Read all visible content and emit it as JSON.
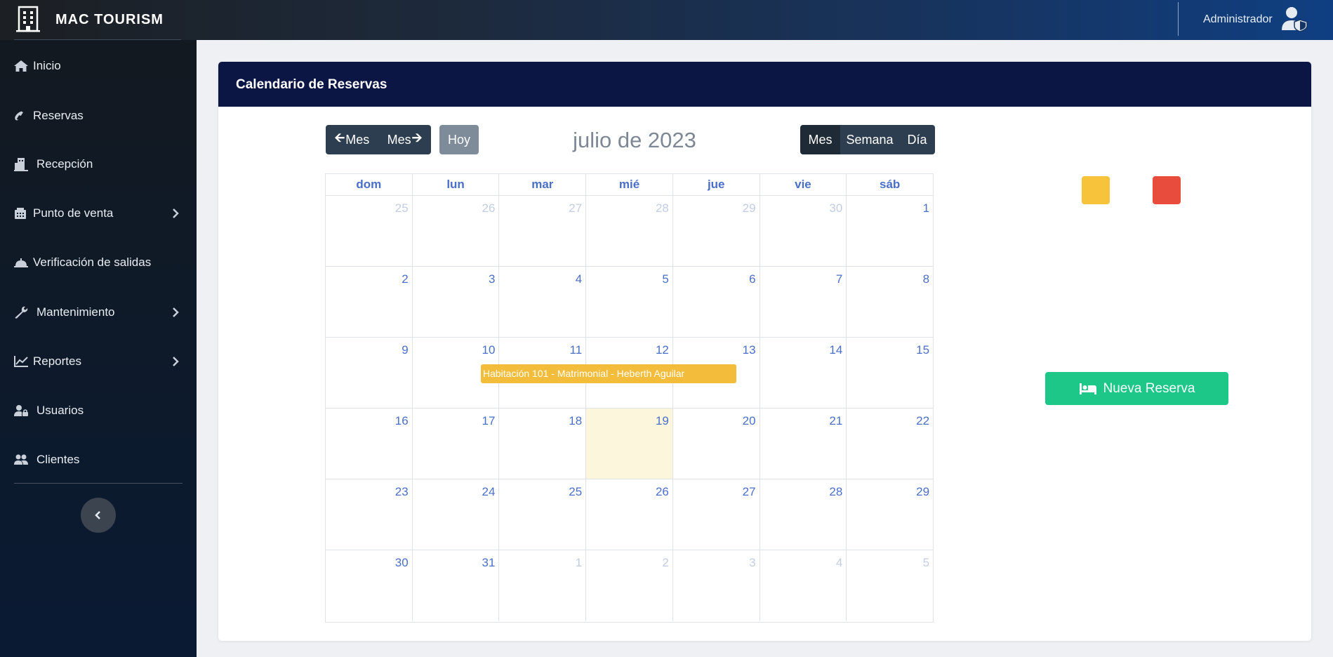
{
  "app": {
    "name": "MAC TOURISM"
  },
  "header": {
    "user_label": "Administrador"
  },
  "sidebar": {
    "items": [
      {
        "label": "Inicio",
        "icon": "home-icon",
        "has_submenu": false
      },
      {
        "label": "Reservas",
        "icon": "phone-icon",
        "has_submenu": false
      },
      {
        "label": "Recepción",
        "icon": "concierge-icon",
        "has_submenu": false
      },
      {
        "label": "Punto de venta",
        "icon": "register-icon",
        "has_submenu": true
      },
      {
        "label": "Verificación de salidas",
        "icon": "bell-icon",
        "has_submenu": false
      },
      {
        "label": "Mantenimiento",
        "icon": "wrench-icon",
        "has_submenu": true
      },
      {
        "label": "Reportes",
        "icon": "chart-icon",
        "has_submenu": true
      },
      {
        "label": "Usuarios",
        "icon": "user-lock-icon",
        "has_submenu": false
      },
      {
        "label": "Clientes",
        "icon": "users-icon",
        "has_submenu": false
      }
    ]
  },
  "page": {
    "title": "Calendario de Reservas"
  },
  "calendar": {
    "title": "julio de 2023",
    "nav": {
      "prev_label": "Mes",
      "next_label": "Mes",
      "today_label": "Hoy"
    },
    "views": [
      {
        "label": "Mes",
        "active": true
      },
      {
        "label": "Semana",
        "active": false
      },
      {
        "label": "Día",
        "active": false
      }
    ],
    "weekday_headers": [
      "dom",
      "lun",
      "mar",
      "mié",
      "jue",
      "vie",
      "sáb"
    ],
    "weeks": [
      [
        {
          "d": "25",
          "o": true
        },
        {
          "d": "26",
          "o": true
        },
        {
          "d": "27",
          "o": true
        },
        {
          "d": "28",
          "o": true
        },
        {
          "d": "29",
          "o": true
        },
        {
          "d": "30",
          "o": true
        },
        {
          "d": "1",
          "o": false
        }
      ],
      [
        {
          "d": "2",
          "o": false
        },
        {
          "d": "3",
          "o": false
        },
        {
          "d": "4",
          "o": false
        },
        {
          "d": "5",
          "o": false
        },
        {
          "d": "6",
          "o": false
        },
        {
          "d": "7",
          "o": false
        },
        {
          "d": "8",
          "o": false
        }
      ],
      [
        {
          "d": "9",
          "o": false
        },
        {
          "d": "10",
          "o": false
        },
        {
          "d": "11",
          "o": false
        },
        {
          "d": "12",
          "o": false
        },
        {
          "d": "13",
          "o": false
        },
        {
          "d": "14",
          "o": false
        },
        {
          "d": "15",
          "o": false
        }
      ],
      [
        {
          "d": "16",
          "o": false
        },
        {
          "d": "17",
          "o": false
        },
        {
          "d": "18",
          "o": false
        },
        {
          "d": "19",
          "o": false,
          "today": true
        },
        {
          "d": "20",
          "o": false
        },
        {
          "d": "21",
          "o": false
        },
        {
          "d": "22",
          "o": false
        }
      ],
      [
        {
          "d": "23",
          "o": false
        },
        {
          "d": "24",
          "o": false
        },
        {
          "d": "25",
          "o": false
        },
        {
          "d": "26",
          "o": false
        },
        {
          "d": "27",
          "o": false
        },
        {
          "d": "28",
          "o": false
        },
        {
          "d": "29",
          "o": false
        }
      ],
      [
        {
          "d": "30",
          "o": false
        },
        {
          "d": "31",
          "o": false
        },
        {
          "d": "1",
          "o": true
        },
        {
          "d": "2",
          "o": true
        },
        {
          "d": "3",
          "o": true
        },
        {
          "d": "4",
          "o": true
        },
        {
          "d": "5",
          "o": true
        }
      ]
    ],
    "events": [
      {
        "label": "Habitación 101 - Matrimonial - Heberth Aguilar",
        "color": "#f3bc3a"
      }
    ]
  },
  "legend": {
    "colors": [
      "#f6c33b",
      "#e74c3c"
    ]
  },
  "actions": {
    "new_reservation_label": "Nueva Reserva"
  },
  "colors": {
    "accent_green": "#1dc787",
    "header_navy": "#0b1645",
    "day_text": "#4a6fc9"
  }
}
